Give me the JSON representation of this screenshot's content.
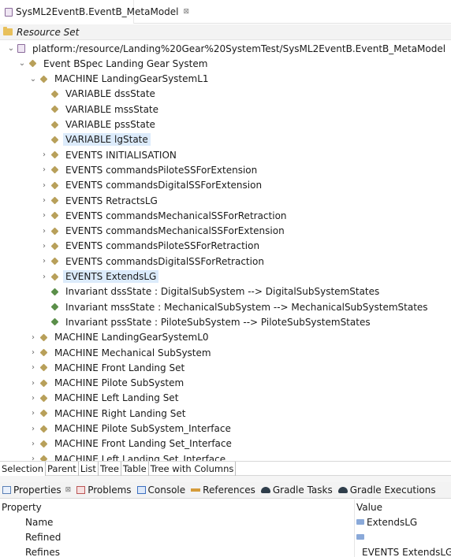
{
  "editor_tab": {
    "title": "SysML2EventB.EventB_MetaModel",
    "close_symbol": "⊠"
  },
  "resource_header": {
    "label": "Resource Set"
  },
  "tree": [
    {
      "label": "platform:/resource/Landing%20Gear%20SystemTest/SysML2EventB.EventB_MetaModel",
      "icon": "resource-icon",
      "chevron": "expanded",
      "level": 0
    },
    {
      "label": "Event BSpec Landing Gear System",
      "icon": "element-icon",
      "chevron": "expanded",
      "level": 1
    },
    {
      "label": "MACHINE LandingGearSystemL1",
      "icon": "element-icon",
      "chevron": "expanded",
      "level": 2
    },
    {
      "label": "VARIABLE dssState",
      "icon": "element-icon",
      "chevron": "none",
      "level": 3
    },
    {
      "label": "VARIABLE mssState",
      "icon": "element-icon",
      "chevron": "none",
      "level": 3
    },
    {
      "label": "VARIABLE pssState",
      "icon": "element-icon",
      "chevron": "none",
      "level": 3
    },
    {
      "label": "VARIABLE lgState",
      "icon": "element-icon",
      "chevron": "none",
      "level": 3,
      "selected": true
    },
    {
      "label": "EVENTS INITIALISATION",
      "icon": "element-icon",
      "chevron": "collapsed",
      "level": 3
    },
    {
      "label": "EVENTS commandsPiloteSSForExtension",
      "icon": "element-icon",
      "chevron": "collapsed",
      "level": 3
    },
    {
      "label": "EVENTS commandsDigitalSSForExtension",
      "icon": "element-icon",
      "chevron": "collapsed",
      "level": 3
    },
    {
      "label": "EVENTS RetractsLG",
      "icon": "element-icon",
      "chevron": "collapsed",
      "level": 3
    },
    {
      "label": "EVENTS commandsMechanicalSSForRetraction",
      "icon": "element-icon",
      "chevron": "collapsed",
      "level": 3
    },
    {
      "label": "EVENTS commandsMechanicalSSForExtension",
      "icon": "element-icon",
      "chevron": "collapsed",
      "level": 3
    },
    {
      "label": "EVENTS commandsPiloteSSForRetraction",
      "icon": "element-icon",
      "chevron": "collapsed",
      "level": 3
    },
    {
      "label": "EVENTS commandsDigitalSSForRetraction",
      "icon": "element-icon",
      "chevron": "collapsed",
      "level": 3
    },
    {
      "label": "EVENTS ExtendsLG",
      "icon": "element-icon",
      "chevron": "collapsed",
      "level": 3,
      "selected": true
    },
    {
      "label": "Invariant dssState : DigitalSubSystem --> DigitalSubSystemStates",
      "icon": "invariant-icon",
      "chevron": "none",
      "level": 3
    },
    {
      "label": "Invariant mssState : MechanicalSubSystem --> MechanicalSubSystemStates",
      "icon": "invariant-icon",
      "chevron": "none",
      "level": 3
    },
    {
      "label": "Invariant pssState : PiloteSubSystem --> PiloteSubSystemStates",
      "icon": "invariant-icon",
      "chevron": "none",
      "level": 3
    },
    {
      "label": "MACHINE LandingGearSystemL0",
      "icon": "element-icon",
      "chevron": "collapsed",
      "level": 2
    },
    {
      "label": "MACHINE Mechanical SubSystem",
      "icon": "element-icon",
      "chevron": "collapsed",
      "level": 2
    },
    {
      "label": "MACHINE Front Landing Set",
      "icon": "element-icon",
      "chevron": "collapsed",
      "level": 2
    },
    {
      "label": "MACHINE Pilote SubSystem",
      "icon": "element-icon",
      "chevron": "collapsed",
      "level": 2
    },
    {
      "label": "MACHINE Left Landing Set",
      "icon": "element-icon",
      "chevron": "collapsed",
      "level": 2
    },
    {
      "label": "MACHINE Right Landing Set",
      "icon": "element-icon",
      "chevron": "collapsed",
      "level": 2
    },
    {
      "label": "MACHINE Pilote SubSystem_Interface",
      "icon": "element-icon",
      "chevron": "collapsed",
      "level": 2
    },
    {
      "label": "MACHINE Front Landing Set_Interface",
      "icon": "element-icon",
      "chevron": "collapsed",
      "level": 2
    },
    {
      "label": "MACHINE Left Landing Set_Interface",
      "icon": "element-icon",
      "chevron": "collapsed",
      "level": 2
    }
  ],
  "subtabs": [
    "Selection",
    "Parent",
    "List",
    "Tree",
    "Table",
    "Tree with Columns"
  ],
  "views": [
    {
      "label": "Properties",
      "icon": "properties-icon",
      "close_symbol": "⊠"
    },
    {
      "label": "Problems",
      "icon": "problems-icon"
    },
    {
      "label": "Console",
      "icon": "console-icon"
    },
    {
      "label": "References",
      "icon": "references-icon"
    },
    {
      "label": "Gradle Tasks",
      "icon": "gradle-icon"
    },
    {
      "label": "Gradle Executions",
      "icon": "gradle-icon"
    }
  ],
  "properties": {
    "header_property": "Property",
    "header_value": "Value",
    "rows": [
      {
        "name": "Name",
        "value": "ExtendsLG",
        "value_icon": "text-icon"
      },
      {
        "name": "Refined",
        "value": "",
        "value_icon": "text-icon"
      },
      {
        "name": "Refines",
        "value": "EVENTS ExtendsLGS",
        "value_icon": "element-icon"
      }
    ]
  }
}
